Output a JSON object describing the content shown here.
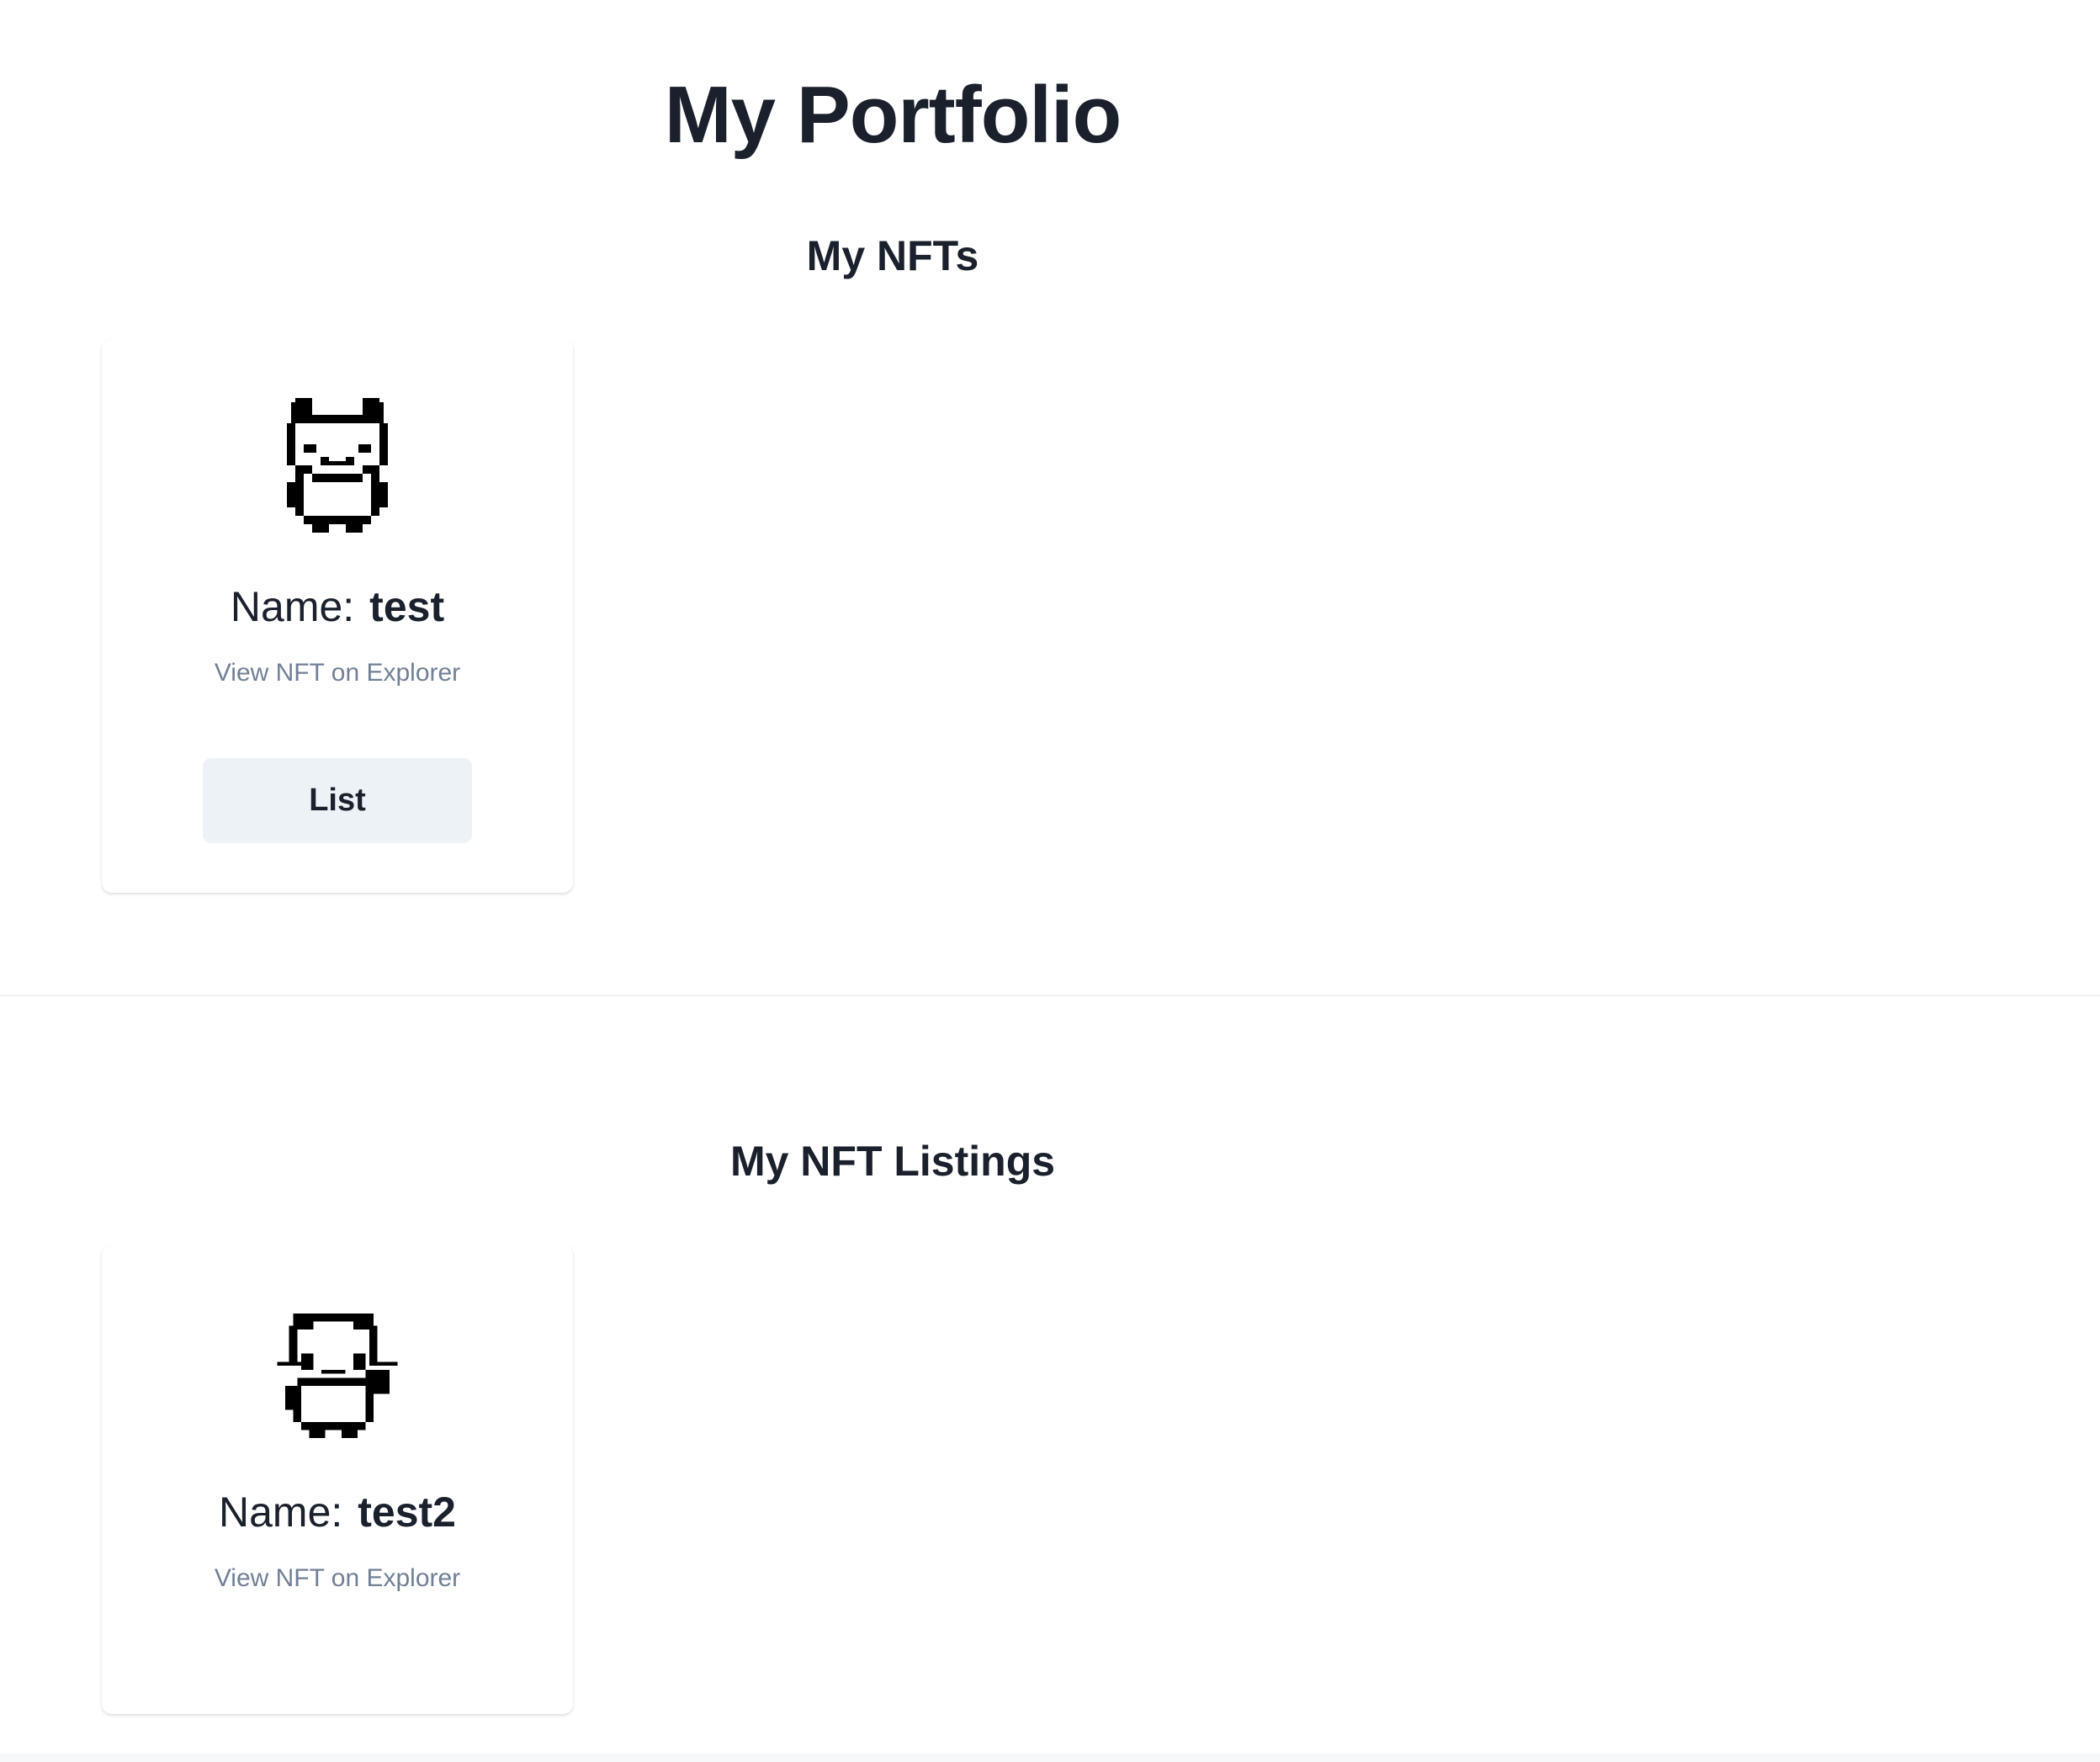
{
  "page": {
    "title": "My Portfolio"
  },
  "my_nfts": {
    "heading": "My NFTs",
    "items": [
      {
        "image_icon": "pixel-panda-icon",
        "name_label": "Name:",
        "name_value": "test",
        "explorer_link": "View NFT on Explorer",
        "list_button": "List"
      }
    ]
  },
  "my_listings": {
    "heading": "My NFT Listings",
    "items": [
      {
        "image_icon": "pixel-panda-waving-icon",
        "name_label": "Name:",
        "name_value": "test2",
        "explorer_link": "View NFT on Explorer"
      }
    ]
  },
  "colors": {
    "text": "#1a202c",
    "muted_text": "#718096",
    "button_bg": "#edf2f7",
    "divider": "#edf0f4"
  }
}
